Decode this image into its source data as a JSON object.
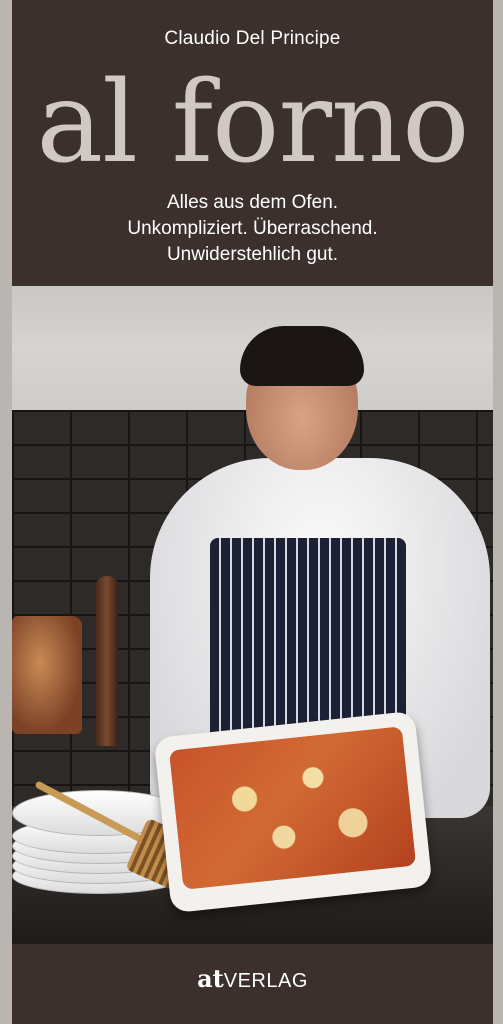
{
  "cover": {
    "author": "Claudio Del Principe",
    "title": "al forno",
    "subtitle_lines": [
      "Alles aus dem Ofen.",
      "Unkompliziert. Überraschend.",
      "Unwiderstehlich gut."
    ],
    "publisher_prefix": "at",
    "publisher_name": "VERLAG"
  },
  "colors": {
    "band": "#3b302b",
    "title": "#cfc9c2",
    "text": "#ffffff"
  }
}
